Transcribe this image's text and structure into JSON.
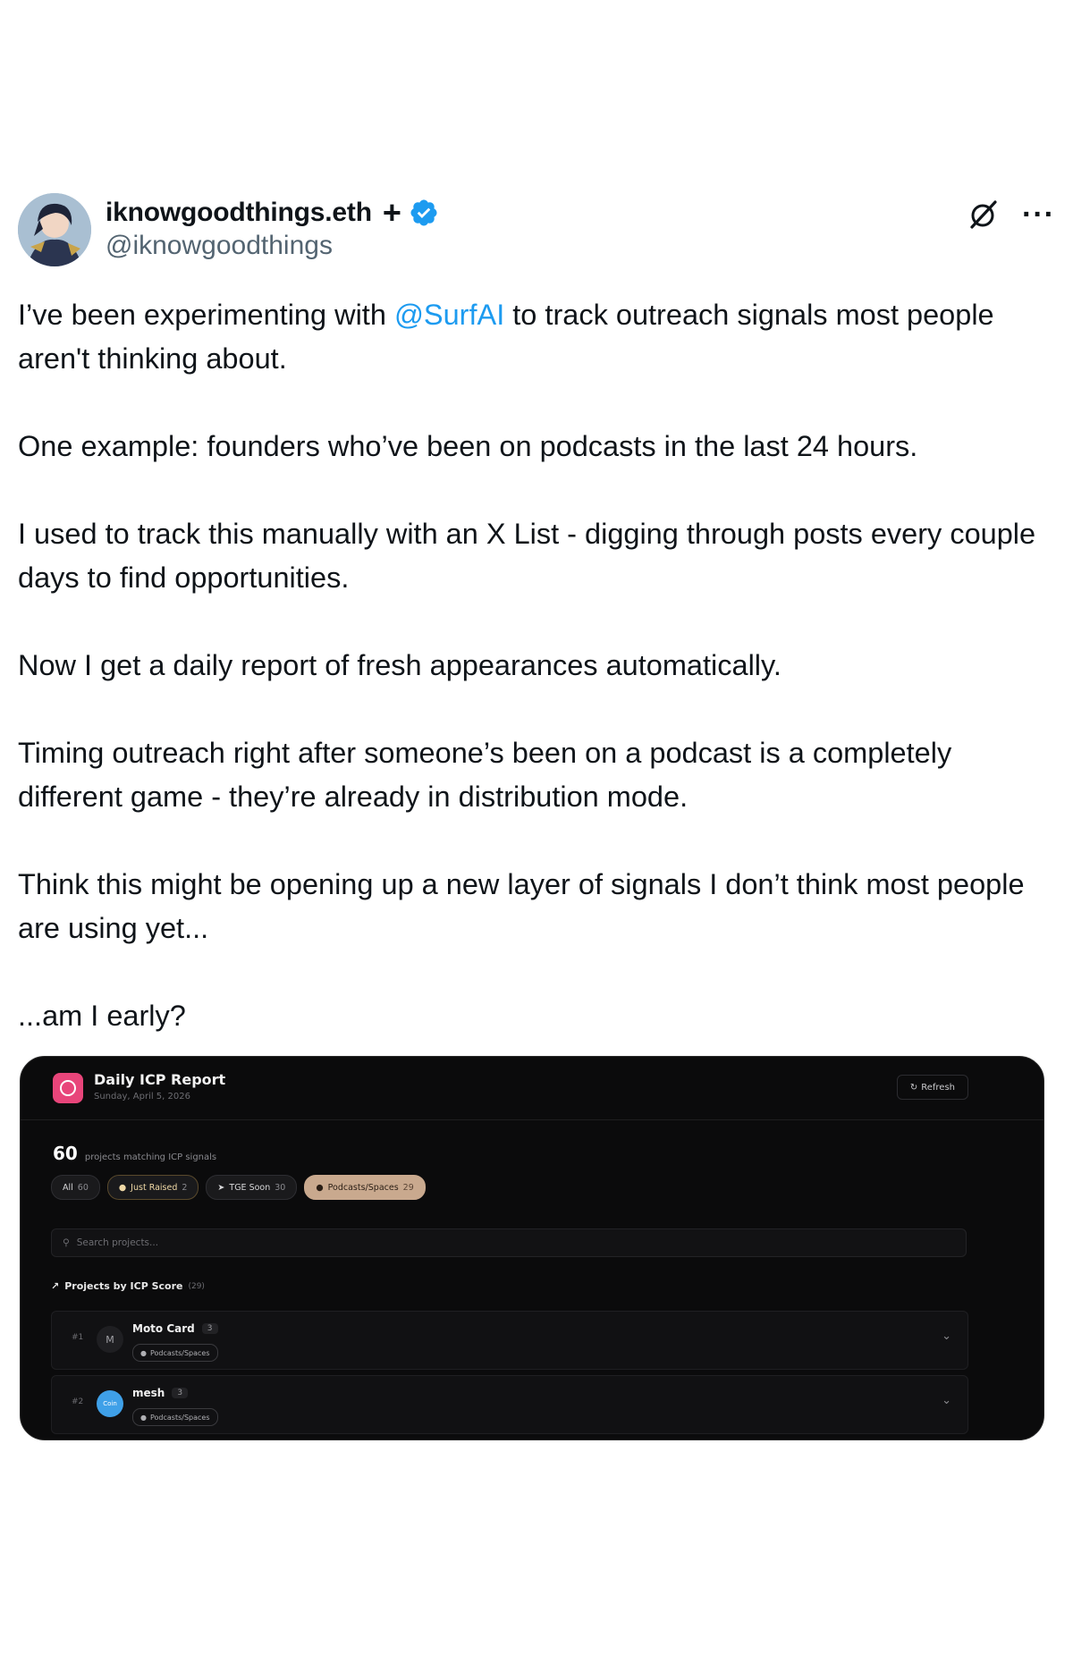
{
  "author": {
    "display_name": "iknowgoodthings.eth",
    "handle": "@iknowgoodthings",
    "avatar_icon": "avatar-image",
    "badges": [
      "plus-icon",
      "verified-icon"
    ]
  },
  "actions": {
    "grok_icon": "grok-icon",
    "more_label": "···"
  },
  "post": {
    "p1_before": "I’ve been experimenting with ",
    "p1_mention": "@SurfAI",
    "p1_after": " to track outreach signals most people aren't thinking about.",
    "p2": "One example: founders who’ve been on podcasts in the last 24 hours.",
    "p3": "I used to track this manually with an X List - digging through posts every couple days to find opportunities.",
    "p4": "Now I get a daily report of fresh appearances automatically.",
    "p5": "Timing outreach right after someone’s been on a podcast is a completely different game - they’re already in distribution mode.",
    "p6": "Think this might be opening up a new layer of signals I don’t think most people are using yet...",
    "p7": "...am I early?"
  },
  "media": {
    "title": "Daily ICP Report",
    "date": "Sunday, April 5, 2026",
    "refresh_label": "Refresh",
    "count": "60",
    "count_label": "projects matching ICP signals",
    "filters": [
      {
        "label": "All",
        "count": "60"
      },
      {
        "label": "Just Raised",
        "count": "2"
      },
      {
        "label": "TGE Soon",
        "count": "30"
      },
      {
        "label": "Podcasts/Spaces",
        "count": "29"
      }
    ],
    "search_placeholder": "Search projects...",
    "section_title": "Projects by ICP Score",
    "section_count": "(29)",
    "rows": [
      {
        "rank": "#1",
        "avatar": "M",
        "name": "Moto Card",
        "score": "3",
        "tag": "Podcasts/Spaces"
      },
      {
        "rank": "#2",
        "avatar": "Coin",
        "name": "mesh",
        "score": "3",
        "tag": "Podcasts/Spaces"
      }
    ]
  },
  "colors": {
    "text": "#0f1419",
    "muted": "#536471",
    "link": "#1d9bf0",
    "verified": "#1d9bf0",
    "media_bg": "#0b0b0c",
    "logo_pink": "#e8457a",
    "active_chip": "#c9a98e"
  }
}
